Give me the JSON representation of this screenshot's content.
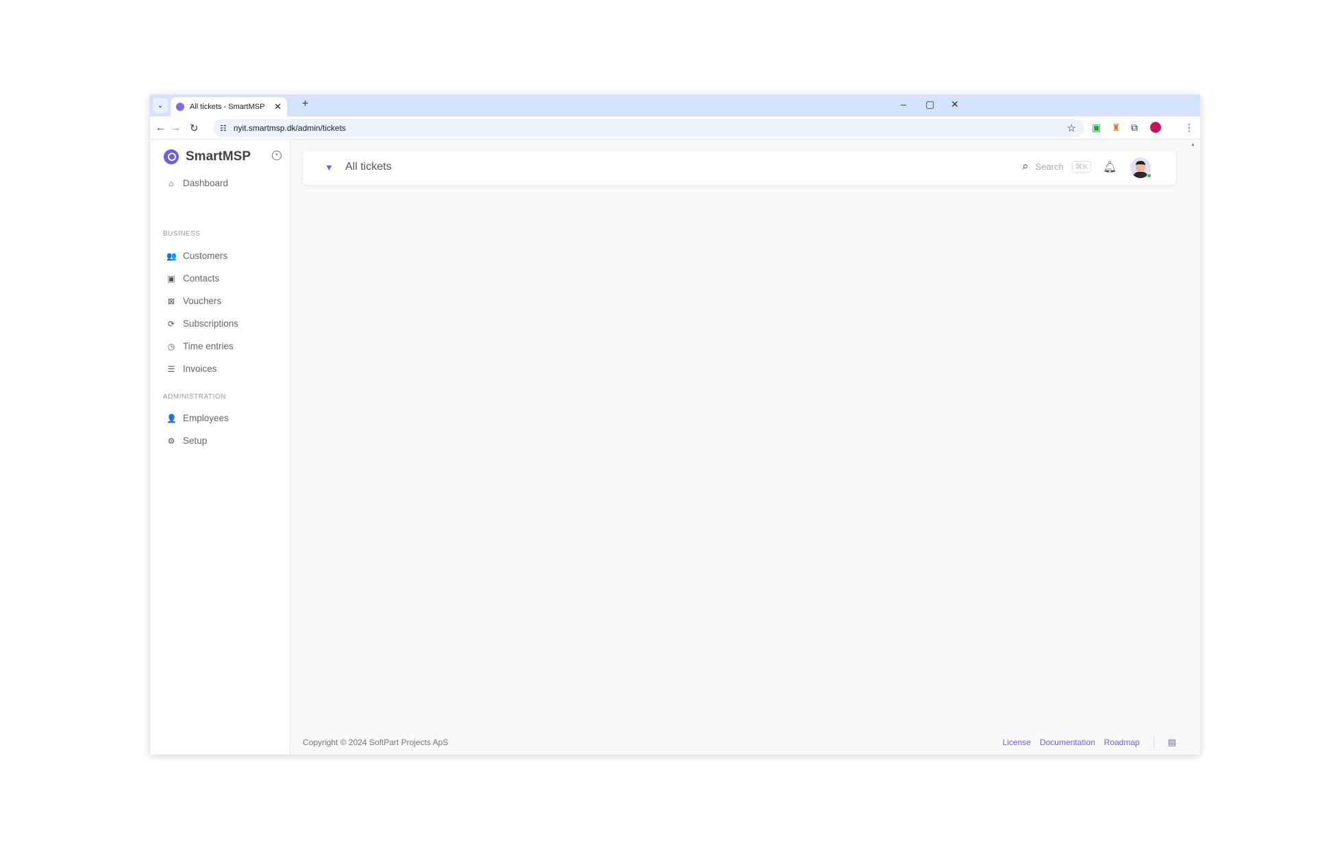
{
  "browser": {
    "tab_title": "All tickets - SmartMSP",
    "url": "nyit.smartmsp.dk/admin/tickets"
  },
  "sidebar": {
    "brand": "SmartMSP",
    "dashboard": "Dashboard",
    "sections": [
      {
        "title": "BUSINESS",
        "items": [
          {
            "label": "Customers",
            "icon": "users-icon"
          },
          {
            "label": "Contacts",
            "icon": "contact-card-icon"
          },
          {
            "label": "Vouchers",
            "icon": "ticket-icon"
          },
          {
            "label": "Subscriptions",
            "icon": "refresh-icon"
          },
          {
            "label": "Time entries",
            "icon": "clock-icon"
          },
          {
            "label": "Invoices",
            "icon": "document-list-icon"
          }
        ]
      },
      {
        "title": "ADMINISTRATION",
        "items": [
          {
            "label": "Employees",
            "icon": "user-icon"
          },
          {
            "label": "Setup",
            "icon": "gear-icon"
          }
        ]
      }
    ]
  },
  "header": {
    "title": "All tickets",
    "search_placeholder": "Search",
    "shortcut": "⌘K"
  },
  "footer": {
    "copyright": "Copyright © 2024 SoftPart Projects ApS",
    "links": [
      "License",
      "Documentation",
      "Roadmap"
    ]
  },
  "colors": {
    "accent": "#6d5ce8",
    "tabbar": "#d3e3fd"
  }
}
